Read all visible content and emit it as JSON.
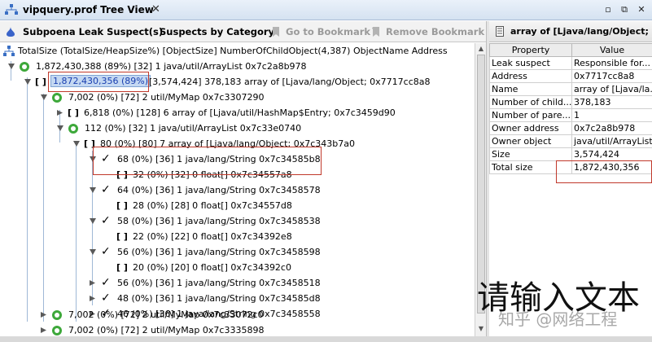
{
  "window": {
    "title": "vipquery.prof Tree View",
    "close": "✕"
  },
  "toolbar": {
    "leak_suspects": "Subpoena Leak Suspect(s)",
    "by_category": "Suspects by Category",
    "goto_bookmark": "Go to Bookmark",
    "remove_bookmark": "Remove Bookmark"
  },
  "tree": {
    "header": "TotalSize (TotalSize/HeapSize%) [ObjectSize] NumberOfChildObject(4,387) ObjectName Address",
    "rows": [
      {
        "text": "1,872,430,388 (89%) [32] 1 java/util/ArrayList 0x7c2a8b978"
      },
      {
        "sel": "1,872,430,356 (89%)",
        "text": "[3,574,424] 378,183 array of [Ljava/lang/Object; 0x7717cc8a8"
      },
      {
        "text": "7,002 (0%) [72] 2 util/MyMap 0x7c3307290"
      },
      {
        "text": "6,818 (0%) [128] 6 array of [Ljava/util/HashMap$Entry; 0x7c3459d90"
      },
      {
        "text": "112 (0%) [32] 1 java/util/ArrayList 0x7c33e0740"
      },
      {
        "text": "80 (0%) [80] 7 array of [Ljava/lang/Object; 0x7c343b7a0"
      },
      {
        "text": "68 (0%) [36] 1 java/lang/String 0x7c34585b8"
      },
      {
        "text": "32 (0%) [32] 0 float[] 0x7c34557a8"
      },
      {
        "text": "64 (0%) [36] 1 java/lang/String 0x7c3458578"
      },
      {
        "text": "28 (0%) [28] 0 float[] 0x7c34557d8"
      },
      {
        "text": "58 (0%) [36] 1 java/lang/String 0x7c3458538"
      },
      {
        "text": "22 (0%) [22] 0 float[] 0x7c34392e8"
      },
      {
        "text": "56 (0%) [36] 1 java/lang/String 0x7c3458598"
      },
      {
        "text": "20 (0%) [20] 0 float[] 0x7c34392c0"
      },
      {
        "text": "56 (0%) [36] 1 java/lang/String 0x7c3458518"
      },
      {
        "text": "48 (0%) [36] 1 java/lang/String 0x7c34585d8"
      },
      {
        "text": "46 (0%) [36] 1 java/lang/String 0x7c3458558"
      },
      {
        "text": "7,002 (0%) [72] 2 util/MyMap 0x7c33072c0"
      },
      {
        "text": "7,002 (0%) [72] 2 util/MyMap 0x7c3335898"
      }
    ]
  },
  "props_panel": {
    "title": "array of [Ljava/lang/Object; a...",
    "col_property": "Property",
    "col_value": "Value",
    "rows": [
      {
        "property": "Leak suspect",
        "value": "Responsible for..."
      },
      {
        "property": "Address",
        "value": "0x7717cc8a8"
      },
      {
        "property": "Name",
        "value": "array of [Ljava/la..."
      },
      {
        "property": "Number of child...",
        "value": "378,183"
      },
      {
        "property": "Number of pare...",
        "value": "1"
      },
      {
        "property": "Owner address",
        "value": "0x7c2a8b978"
      },
      {
        "property": "Owner object",
        "value": "java/util/ArrayList"
      },
      {
        "property": "Size",
        "value": "3,574,424"
      },
      {
        "property": "Total size",
        "value": "1,872,430,356"
      }
    ]
  },
  "overlay": {
    "text": "请输入文本",
    "watermark": "知乎 @网络工程"
  }
}
